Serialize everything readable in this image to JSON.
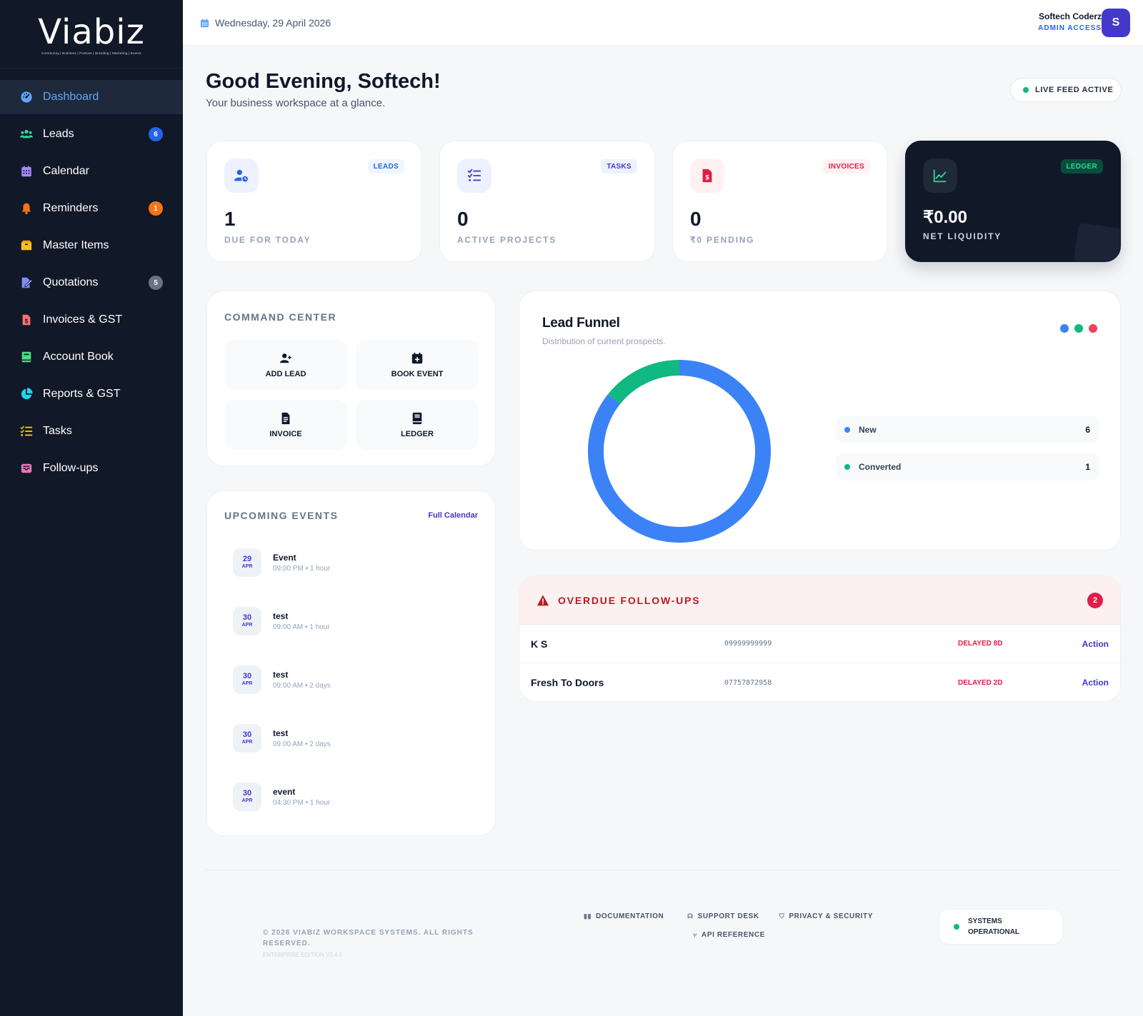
{
  "brand": {
    "name": "Viabiz",
    "tagline": "Community | Business | Podcast | Branding | Marketing | Events"
  },
  "sidebar": {
    "items": [
      {
        "label": "Dashboard",
        "icon": "gauge-icon",
        "badge": null,
        "active": true
      },
      {
        "label": "Leads",
        "icon": "users-icon",
        "badge": "6"
      },
      {
        "label": "Calendar",
        "icon": "calendar-icon",
        "badge": null
      },
      {
        "label": "Reminders",
        "icon": "bell-icon",
        "badge": "1"
      },
      {
        "label": "Master Items",
        "icon": "box-icon",
        "badge": null
      },
      {
        "label": "Quotations",
        "icon": "file-signature-icon",
        "badge": "5"
      },
      {
        "label": "Invoices & GST",
        "icon": "invoice-icon",
        "badge": null
      },
      {
        "label": "Account Book",
        "icon": "book-icon",
        "badge": null
      },
      {
        "label": "Reports & GST",
        "icon": "pie-chart-icon",
        "badge": null
      },
      {
        "label": "Tasks",
        "icon": "list-check-icon",
        "badge": null
      },
      {
        "label": "Follow-ups",
        "icon": "inbox-icon",
        "badge": null
      }
    ]
  },
  "header": {
    "date": "Wednesday, 29 April 2026",
    "user_name": "Softech Coderz",
    "user_role": "ADMIN ACCESS",
    "avatar_initial": "S"
  },
  "greeting": {
    "title": "Good Evening, Softech!",
    "subtitle": "Your business workspace at a glance.",
    "live_label": "LIVE FEED ACTIVE"
  },
  "stats": [
    {
      "tag": "LEADS",
      "value": "1",
      "label": "DUE FOR TODAY"
    },
    {
      "tag": "TASKS",
      "value": "0",
      "label": "ACTIVE PROJECTS"
    },
    {
      "tag": "INVOICES",
      "value": "0",
      "label": "₹0 PENDING"
    },
    {
      "tag": "LEDGER",
      "value": "₹0.00",
      "label": "NET LIQUIDITY"
    }
  ],
  "command_center": {
    "title": "COMMAND CENTER",
    "buttons": [
      {
        "label": "ADD LEAD",
        "icon": "user-plus-icon"
      },
      {
        "label": "BOOK EVENT",
        "icon": "calendar-plus-icon"
      },
      {
        "label": "INVOICE",
        "icon": "file-invoice-icon"
      },
      {
        "label": "LEDGER",
        "icon": "book-icon"
      }
    ]
  },
  "upcoming_events": {
    "title": "UPCOMING EVENTS",
    "link": "Full Calendar",
    "items": [
      {
        "day": "29",
        "month": "APR",
        "title": "Event",
        "time": "09:00 PM • 1 hour"
      },
      {
        "day": "30",
        "month": "APR",
        "title": "test",
        "time": "09:00 AM • 1 hour"
      },
      {
        "day": "30",
        "month": "APR",
        "title": "test",
        "time": "09:00 AM • 2 days"
      },
      {
        "day": "30",
        "month": "APR",
        "title": "test",
        "time": "09:00 AM • 2 days"
      },
      {
        "day": "30",
        "month": "APR",
        "title": "event",
        "time": "04:30 PM • 1 hour"
      }
    ]
  },
  "lead_funnel": {
    "title": "Lead Funnel",
    "subtitle": "Distribution of current prospects."
  },
  "chart_data": {
    "type": "pie",
    "variant": "doughnut",
    "categories": [
      "New",
      "Converted"
    ],
    "values": [
      6,
      1
    ],
    "colors": [
      "#3b82f6",
      "#10b981"
    ],
    "legend_dots": [
      "#3b82f6",
      "#10b981",
      "#f43f5e"
    ],
    "legend_placement": "right"
  },
  "overdue": {
    "title": "OVERDUE FOLLOW-UPS",
    "count": "2",
    "rows": [
      {
        "name": "K S",
        "phone": "09999999999",
        "status": "DELAYED 8D",
        "action": "Action"
      },
      {
        "name": "Fresh To Doors",
        "phone": "07757872958",
        "status": "DELAYED 2D",
        "action": "Action"
      }
    ]
  },
  "footer": {
    "copyright": "© 2026 VIABIZ WORKSPACE SYSTEMS. ALL RIGHTS RESERVED.",
    "edition": "ENTERPRISE EDITION V2.4.0",
    "links": [
      "DOCUMENTATION",
      "SUPPORT DESK",
      "PRIVACY & SECURITY",
      "API REFERENCE"
    ],
    "status": "SYSTEMS OPERATIONAL"
  },
  "colors": {
    "accent": "#4338ca",
    "sidebar": "#111827",
    "primary_blue": "#2563eb",
    "success": "#10b981",
    "danger": "#e11d48"
  }
}
